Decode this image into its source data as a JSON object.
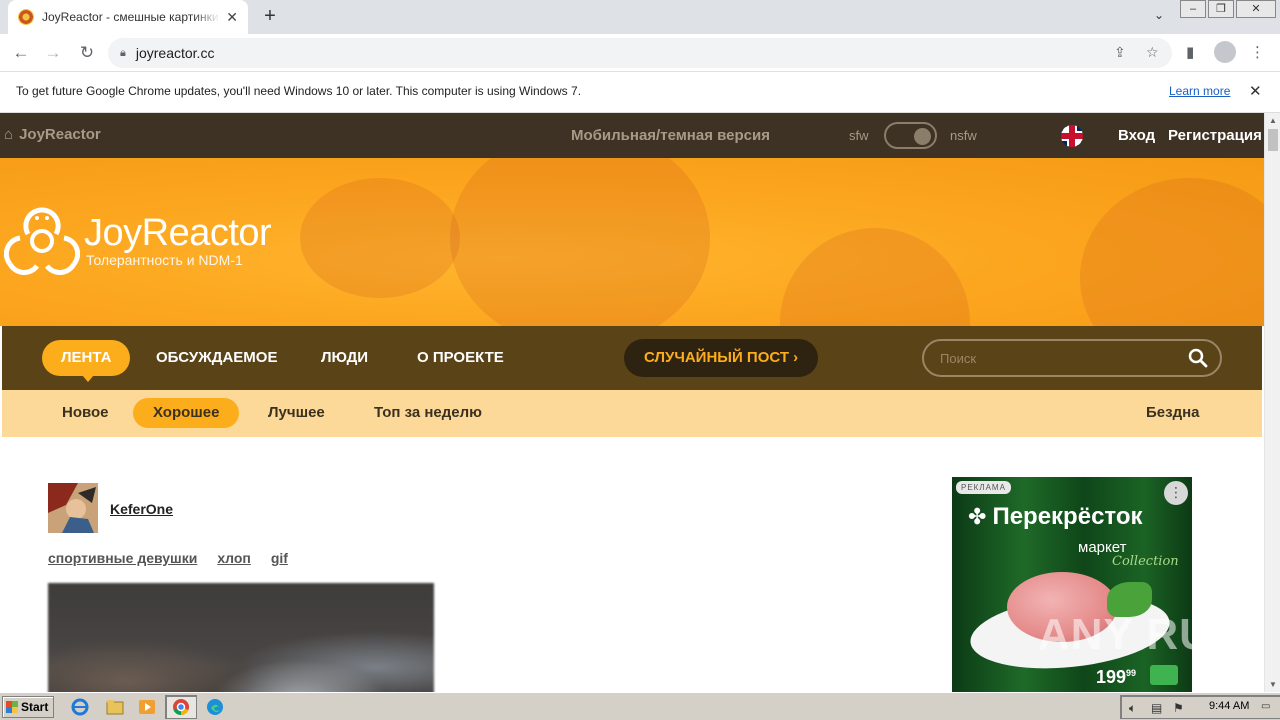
{
  "browser": {
    "tab_title": "JoyReactor - смешные картинки и",
    "tab_close": "✕",
    "new_tab": "+",
    "url": "joyreactor.cc",
    "window_controls": [
      "‒",
      "❐",
      "✕"
    ]
  },
  "infobar": {
    "message": "To get future Google Chrome updates, you'll need Windows 10 or later. This computer is using Windows 7.",
    "learn_more": "Learn more",
    "close": "✕"
  },
  "sitebar": {
    "home": "JoyReactor",
    "mobile_version": "Мобильная/темная версия",
    "sfw": "sfw",
    "nsfw": "nsfw",
    "login": "Вход",
    "register": "Регистрация"
  },
  "banner": {
    "brand": "JoyReactor",
    "slogan": "Толерантность и NDM-1"
  },
  "mainnav": {
    "items": [
      "ЛЕНТА",
      "ОБСУЖДАЕМОЕ",
      "ЛЮДИ",
      "О ПРОЕКТЕ"
    ],
    "random": "СЛУЧАЙНЫЙ ПОСТ ›",
    "search_placeholder": "Поиск"
  },
  "subnav": {
    "items": [
      "Новое",
      "Хорошее",
      "Лучшее",
      "Топ за неделю"
    ],
    "abyss": "Бездна"
  },
  "post": {
    "author": "KeferOne",
    "tags": [
      "спортивные девушки",
      "хлоп",
      "gif"
    ]
  },
  "ad": {
    "label": "РЕКЛАМА",
    "menu": "⋮",
    "brand": "Перекрёсток",
    "market": "маркет",
    "collection": "Collection",
    "price": "199",
    "price_cents": "99"
  },
  "watermark": "ANY RUN",
  "taskbar": {
    "start": "Start",
    "time": "9:44 AM"
  },
  "colors": {
    "accent": "#fcad1c",
    "sitebar": "#3d3224",
    "mainnav": "#5b4318",
    "subnav": "#fdd999"
  }
}
